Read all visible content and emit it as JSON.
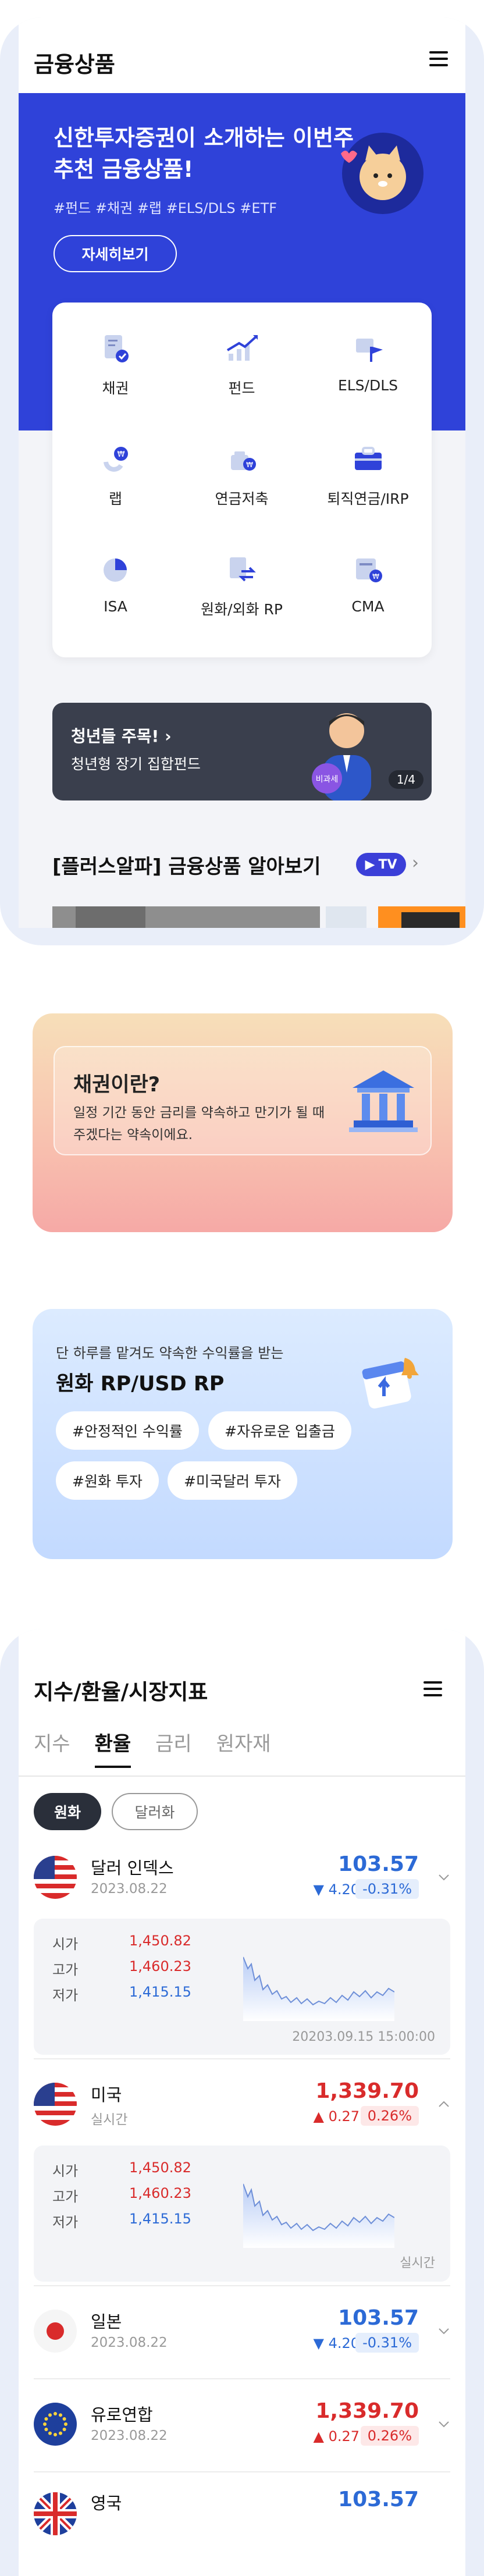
{
  "products": {
    "title": "금융상품",
    "hero": {
      "title": "신한투자증권이 소개하는 이번주 추천 금융상품!",
      "tags": "#펀드 #채권 #랩 #ELS/DLS #ETF",
      "button": "자세히보기"
    },
    "menu": [
      {
        "label": "채권",
        "icon": "bond-doc-icon"
      },
      {
        "label": "펀드",
        "icon": "fund-chart-icon"
      },
      {
        "label": "ELS/DLS",
        "icon": "els-flag-icon"
      },
      {
        "label": "랩",
        "icon": "wrap-icon"
      },
      {
        "label": "연금저축",
        "icon": "pension-icon"
      },
      {
        "label": "퇴직연금/IRP",
        "icon": "briefcase-icon"
      },
      {
        "label": "ISA",
        "icon": "pie-icon"
      },
      {
        "label": "원화/외화 RP",
        "icon": "exchange-icon"
      },
      {
        "label": "CMA",
        "icon": "cma-icon"
      }
    ],
    "promo": {
      "title": "청년들 주목!",
      "subtitle": "청년형 장기 집합펀드",
      "badge": "비과세",
      "page": "1/4"
    },
    "plus_alpha": {
      "title": "[플러스알파] 금융상품 알아보기",
      "tv": "TV"
    }
  },
  "bond_card": {
    "title": "채권이란?",
    "desc": "일정 기간 동안 금리를 약속하고 만기가 될 때 주겠다는 약속이에요."
  },
  "rp_card": {
    "subtitle": "단 하루를 맡겨도 약속한 수익률을 받는",
    "title": "원화 RP/USD RP",
    "chips": [
      "#안정적인 수익률",
      "#자유로운 입출금",
      "#원화 투자",
      "#미국달러 투자"
    ]
  },
  "market": {
    "title": "지수/환율/시장지표",
    "tabs": [
      "지수",
      "환율",
      "금리",
      "원자재"
    ],
    "active_tab": "환율",
    "segments": [
      "원화",
      "달러화"
    ],
    "rows": [
      {
        "name": "달러 인덱스",
        "date": "2023.08.22",
        "value": "103.57",
        "change": "4.20",
        "pct": "-0.31%",
        "dir": "down",
        "flag": "us",
        "detail": {
          "open_label": "시가",
          "open": "1,450.82",
          "high_label": "고가",
          "high": "1,460.23",
          "low_label": "저가",
          "low": "1,415.15",
          "footer": "20203.09.15 15:00:00"
        }
      },
      {
        "name": "미국",
        "date": "실시간",
        "value": "1,339.70",
        "change": "0.27",
        "pct": "0.26%",
        "dir": "up",
        "flag": "us",
        "detail": {
          "open_label": "시가",
          "open": "1,450.82",
          "high_label": "고가",
          "high": "1,460.23",
          "low_label": "저가",
          "low": "1,415.15",
          "footer": "실시간"
        }
      },
      {
        "name": "일본",
        "date": "2023.08.22",
        "value": "103.57",
        "change": "4.20",
        "pct": "-0.31%",
        "dir": "down",
        "flag": "jp"
      },
      {
        "name": "유로연합",
        "date": "2023.08.22",
        "value": "1,339.70",
        "change": "0.27",
        "pct": "0.26%",
        "dir": "up",
        "flag": "eu"
      },
      {
        "name": "영국",
        "value": "103.57",
        "flag": "gb"
      }
    ]
  },
  "colors": {
    "brand_blue": "#2f42d9",
    "up_red": "#d92b2b",
    "down_blue": "#2c6ad6"
  }
}
